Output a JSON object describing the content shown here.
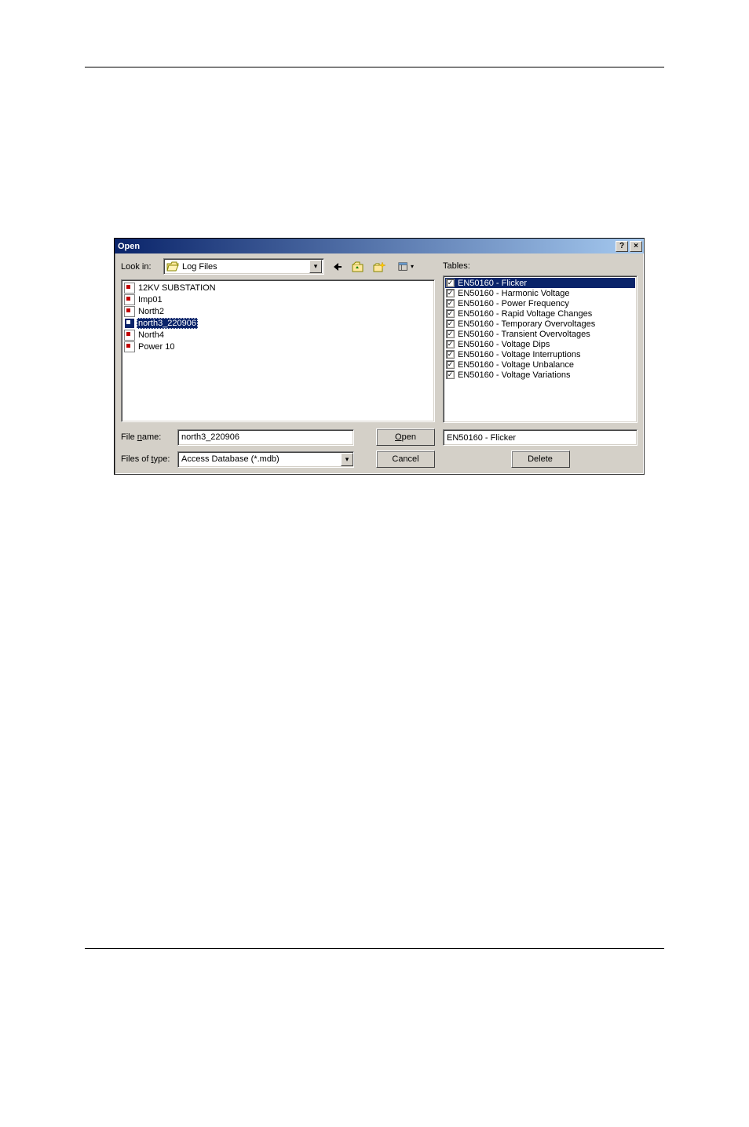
{
  "dialog": {
    "title": "Open",
    "title_btn_help": "?",
    "title_btn_close": "×"
  },
  "lookin": {
    "label": "Look in:",
    "folder_name": "Log Files"
  },
  "toolbar": {
    "back": "back-icon",
    "up": "up-one-level-icon",
    "newfolder": "new-folder-icon",
    "views": "views-icon"
  },
  "files": [
    {
      "name": "12KV SUBSTATION",
      "selected": false
    },
    {
      "name": "Imp01",
      "selected": false
    },
    {
      "name": "North2",
      "selected": false
    },
    {
      "name": "north3_220906",
      "selected": true
    },
    {
      "name": "North4",
      "selected": false
    },
    {
      "name": "Power 10",
      "selected": false
    }
  ],
  "footer": {
    "filename_label": "File name:",
    "filename_value": "north3_220906",
    "filetype_label": "Files of type:",
    "filetype_value": "Access Database (*.mdb)",
    "open": "Open",
    "open_u": "O",
    "cancel": "Cancel"
  },
  "tables": {
    "label": "Tables:",
    "items": [
      {
        "name": "EN50160 - Flicker",
        "selected": true
      },
      {
        "name": "EN50160 - Harmonic Voltage",
        "selected": false
      },
      {
        "name": "EN50160 - Power Frequency",
        "selected": false
      },
      {
        "name": "EN50160 - Rapid Voltage Changes",
        "selected": false
      },
      {
        "name": "EN50160 - Temporary Overvoltages",
        "selected": false
      },
      {
        "name": "EN50160 - Transient Overvoltages",
        "selected": false
      },
      {
        "name": "EN50160 - Voltage Dips",
        "selected": false
      },
      {
        "name": "EN50160 - Voltage Interruptions",
        "selected": false
      },
      {
        "name": "EN50160 - Voltage Unbalance",
        "selected": false
      },
      {
        "name": "EN50160 - Voltage Variations",
        "selected": false
      }
    ],
    "selected_value": "EN50160 - Flicker",
    "delete": "Delete"
  }
}
